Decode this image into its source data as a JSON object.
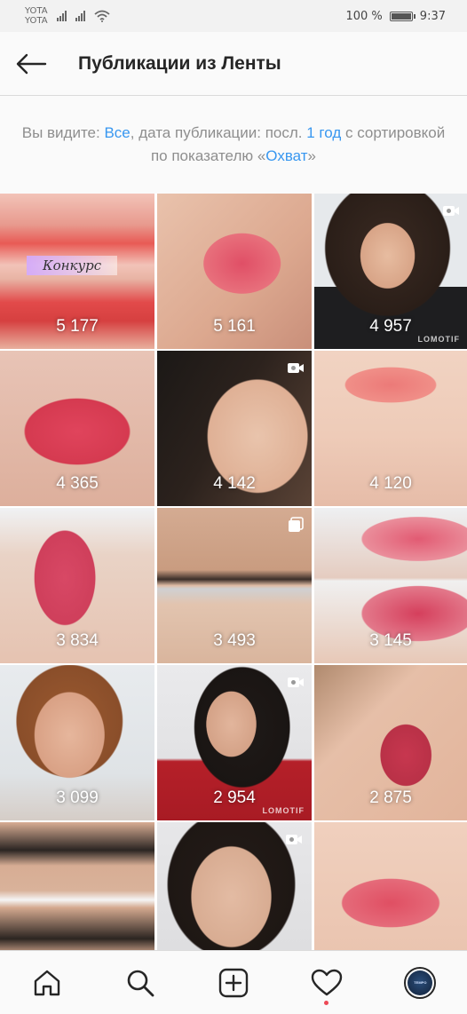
{
  "status_bar": {
    "carrier_1": "YOTA",
    "carrier_2": "YOTA",
    "battery_percent": "100 %",
    "time": "9:37"
  },
  "header": {
    "title": "Публикации из Ленты"
  },
  "filter": {
    "part1": "Вы видите: ",
    "scope": "Все",
    "part2": ", дата публикации: посл. ",
    "period": "1 год",
    "part3": " с сортировкой по показателю «",
    "metric": "Охват",
    "part4": "»"
  },
  "grid": {
    "contest_label": "Конкурс",
    "watermark": "LOMOTIF",
    "tiles": [
      {
        "count": "5 177",
        "icon": "none"
      },
      {
        "count": "5 161",
        "icon": "none"
      },
      {
        "count": "4 957",
        "icon": "video-icon"
      },
      {
        "count": "4 365",
        "icon": "none"
      },
      {
        "count": "4 142",
        "icon": "video-icon"
      },
      {
        "count": "4 120",
        "icon": "none"
      },
      {
        "count": "3 834",
        "icon": "none"
      },
      {
        "count": "3 493",
        "icon": "carousel-icon"
      },
      {
        "count": "3 145",
        "icon": "none"
      },
      {
        "count": "3 099",
        "icon": "none"
      },
      {
        "count": "2 954",
        "icon": "video-icon"
      },
      {
        "count": "2 875",
        "icon": "none"
      },
      {
        "count": "",
        "icon": "none"
      },
      {
        "count": "",
        "icon": "none"
      },
      {
        "count": "",
        "icon": "video-icon"
      },
      {
        "count": "",
        "icon": "none"
      }
    ]
  },
  "bottom_nav": {
    "items": [
      "home-icon",
      "search-icon",
      "add-post-icon",
      "activity-icon",
      "profile-avatar"
    ],
    "avatar_text": "TEMPO"
  },
  "colors": {
    "link": "#3897f0",
    "notification": "#ed4956"
  }
}
